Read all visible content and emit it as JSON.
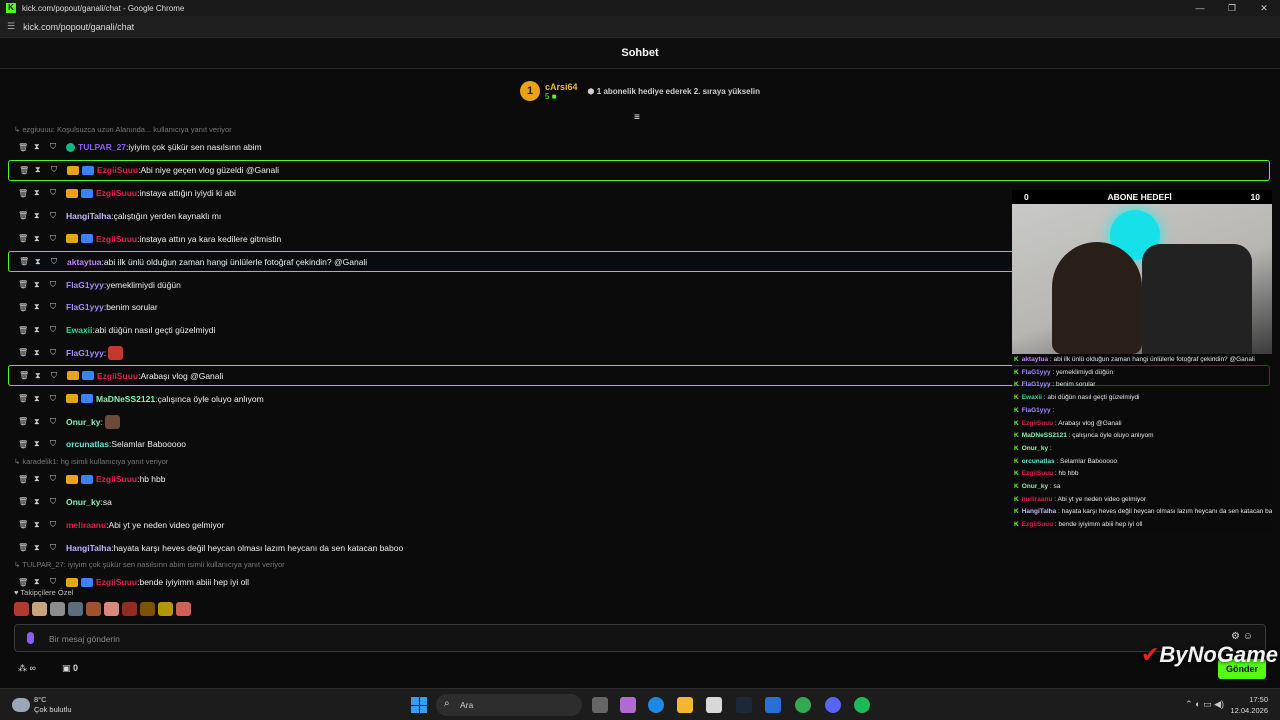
{
  "window": {
    "title": "kick.com/popout/ganali/chat - Google Chrome",
    "url": "kick.com/popout/ganali/chat",
    "controls": [
      "—",
      "❐",
      "✕"
    ]
  },
  "header": {
    "title": "Sohbet"
  },
  "leaderboard": {
    "rank": "1",
    "username": "cArsi64",
    "count": "5",
    "hint": "1 abonelik hediye ederek 2. sıraya yükselin"
  },
  "chat": {
    "reply_top": "↳ ezgiuuuu: Koşulsuzca uzun Alanında... kullanıcıya yanıt veriyor",
    "messages": [
      {
        "user": "TULPAR_27",
        "color": "#8b5cf6",
        "text": "iyiyim çok şükür sen nasılsınn abim",
        "badges": [
          "verified"
        ],
        "hl": false
      },
      {
        "user": "EzgiiSuuu",
        "color": "#e11d48",
        "text": "Abi niye geçen vlog güzeldi @Ganali",
        "badges": [
          "crown",
          "gift"
        ],
        "hl": true
      },
      {
        "user": "EzgiiSuuu",
        "color": "#e11d48",
        "text": "instaya attığın iyiydi ki abi",
        "badges": [
          "crown",
          "gift"
        ],
        "hl": false
      },
      {
        "user": "HangiTalha",
        "color": "#c4b5fd",
        "text": "çalıştığın yerden kaynaklı mı",
        "badges": [],
        "hl": false
      },
      {
        "user": "EzgiiSuuu",
        "color": "#e11d48",
        "text": "instaya attın ya kara kedilere gitmistin",
        "badges": [
          "crown",
          "gift"
        ],
        "hl": false
      },
      {
        "user": "aktaytua",
        "color": "#c084fc",
        "text": "abi ilk ünlü olduğun zaman hangi ünlülerle fotoğraf çekindin? @Ganali",
        "badges": [],
        "hl": true
      },
      {
        "user": "FlaG1yyy",
        "color": "#a78bfa",
        "text": "yemeklimiydi düğün",
        "badges": [],
        "hl": false
      },
      {
        "user": "FlaG1yyy",
        "color": "#a78bfa",
        "text": "benim sorular",
        "badges": [],
        "hl": false
      },
      {
        "user": "Ewaxii",
        "color": "#34d399",
        "text": "abi düğün nasıl geçti güzelmiydi",
        "badges": [],
        "hl": false
      },
      {
        "user": "FlaG1yyy",
        "color": "#a78bfa",
        "text": "",
        "badges": [],
        "hl": false,
        "emote": "#c0392b"
      },
      {
        "user": "EzgiiSuuu",
        "color": "#e11d48",
        "text": "Arabaşı vlog @Ganali",
        "badges": [
          "crown",
          "gift"
        ],
        "hl": true
      },
      {
        "user": "MaDNeSS2121",
        "color": "#86efac",
        "text": "çalışınca öyle oluyo anlıyom",
        "badges": [
          "crown",
          "gift"
        ],
        "hl": false
      },
      {
        "user": "Onur_ky",
        "color": "#86efac",
        "text": "",
        "badges": [],
        "hl": false,
        "emote": "#6b4a3a"
      },
      {
        "user": "orcunatlas",
        "color": "#5eead4",
        "text": "Selamlar Babooooo",
        "badges": [],
        "hl": false
      }
    ],
    "reply_mid": "↳ karadelik1: hg isimli kullanıcıya yanıt veriyor",
    "messages2": [
      {
        "user": "EzgiiSuuu",
        "color": "#e11d48",
        "text": "hb hbb",
        "badges": [
          "crown",
          "gift"
        ],
        "hl": false
      },
      {
        "user": "Onur_ky",
        "color": "#86efac",
        "text": "sa",
        "badges": [],
        "hl": false
      },
      {
        "user": "meliraanu",
        "color": "#e11d48",
        "text": "Abi yt ye neden video gelmiyor",
        "badges": [],
        "hl": false
      },
      {
        "user": "HangiTalha",
        "color": "#c4b5fd",
        "text": "hayata karşı heves değil heycan olması lazım heycanı da sen katacan baboo",
        "badges": [],
        "hl": false
      }
    ],
    "reply_bottom": "↳ TULPAR_27: iyiyim çok şükür sen nasılsınn abim  isimli kullanıcıya yanıt veriyor",
    "last": {
      "user": "EzgiiSuuu",
      "color": "#e11d48",
      "text": "bende iyiyimm abiii hep iyi oll",
      "badges": [
        "crown",
        "gift"
      ],
      "hl": false
    }
  },
  "followers_label": "♥ Takipçilere Özel",
  "input": {
    "placeholder": "Bir mesaj gönderin"
  },
  "bottom": {
    "infinity": "∞",
    "gift_count": "0",
    "send_label": "Gönder"
  },
  "overlay": {
    "left": "0",
    "title": "ABONE HEDEFİ",
    "right": "10",
    "lines": [
      {
        "user": "aktaytua",
        "color": "#c084fc",
        "text": "abi ilk ünlü olduğun zaman hangi ünlülerle fotoğraf çekindin? @Ganali"
      },
      {
        "user": "FlaG1yyy",
        "color": "#a78bfa",
        "text": "yemeklimiydi düğün"
      },
      {
        "user": "FlaG1yyy",
        "color": "#a78bfa",
        "text": "benim sorular"
      },
      {
        "user": "Ewaxii",
        "color": "#34d399",
        "text": "abi düğün nasıl geçti güzelmiydi"
      },
      {
        "user": "FlaG1yyy",
        "color": "#a78bfa",
        "text": ""
      },
      {
        "user": "EzgiiSuuu",
        "color": "#e11d48",
        "text": "Arabaşı vlog @Ganali"
      },
      {
        "user": "MaDNeSS2121",
        "color": "#86efac",
        "text": "çalışınca öyle oluyo anlıyom"
      },
      {
        "user": "Onur_ky",
        "color": "#86efac",
        "text": ""
      },
      {
        "user": "orcunatlas",
        "color": "#5eead4",
        "text": "Selamlar Babooooo"
      },
      {
        "user": "EzgiiSuuu",
        "color": "#e11d48",
        "text": "hb hbb"
      },
      {
        "user": "Onur_ky",
        "color": "#86efac",
        "text": "sa"
      },
      {
        "user": "meliraanu",
        "color": "#e11d48",
        "text": "Abi yt ye neden video gelmiyor"
      },
      {
        "user": "HangiTalha",
        "color": "#c4b5fd",
        "text": "hayata karşı heves değil heycan olması lazım heycanı da sen katacan baboo"
      },
      {
        "user": "EzgiiSuuu",
        "color": "#e11d48",
        "text": "bende iyiyimm abiii hep iyi oll"
      }
    ]
  },
  "watermark": "ByNoGame",
  "taskbar": {
    "temp": "8°C",
    "weather": "Çok bulutlu",
    "search": "Ara",
    "time": "17:50",
    "date": "12.04.2026"
  }
}
